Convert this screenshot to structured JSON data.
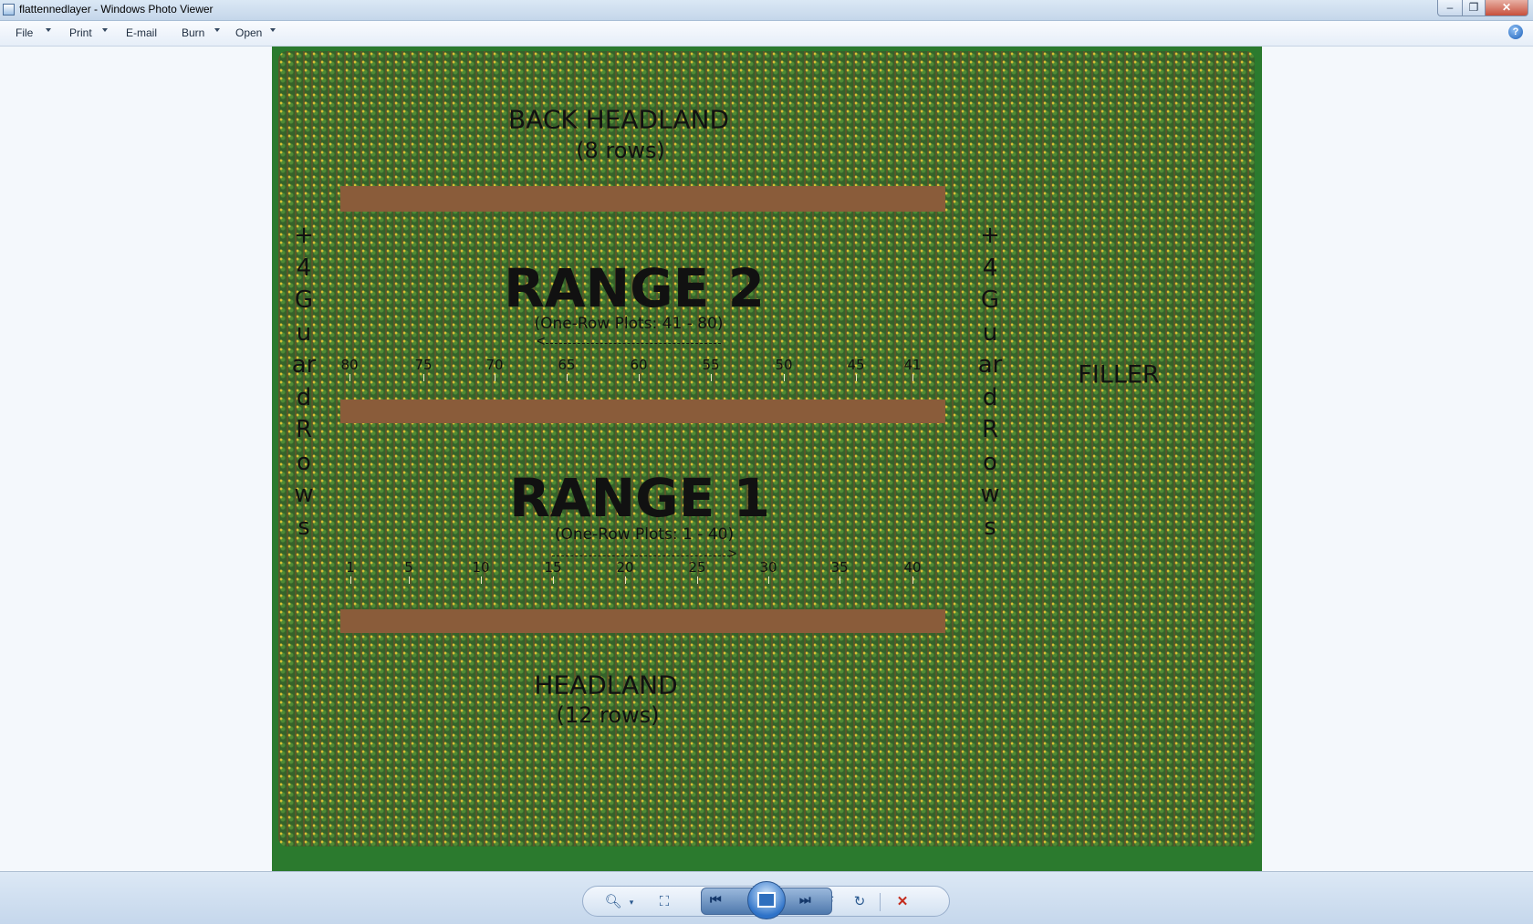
{
  "window": {
    "title": "flattennedlayer - Windows Photo Viewer",
    "min_glyph": "–",
    "max_glyph": "❐",
    "close_glyph": "✕"
  },
  "menu": {
    "file": "File",
    "print": "Print",
    "email": "E-mail",
    "burn": "Burn",
    "open": "Open",
    "help_glyph": "?"
  },
  "field": {
    "back_headland": "BACK HEADLAND",
    "back_headland_rows": "(8 rows)",
    "range2": "RANGE 2",
    "range2_plots": "(One-Row Plots: 41 - 80)",
    "range1": "RANGE 1",
    "range1_plots": "(One-Row Plots: 1 - 40)",
    "headland": "HEADLAND",
    "headland_rows": "(12 rows)",
    "filler": "FILLER",
    "guard_rows": "+4GuardRows",
    "range2_numbers": [
      "80",
      "75",
      "70",
      "65",
      "60",
      "55",
      "50",
      "45",
      "41"
    ],
    "range1_numbers": [
      "1",
      "5",
      "10",
      "15",
      "20",
      "25",
      "30",
      "35",
      "40"
    ],
    "arrow_left": "<",
    "arrow_right": ">"
  },
  "controls": {
    "zoom_icon": "magnifier-icon",
    "zoom_glyph": "🔍︎",
    "fit_glyph": "⛶",
    "prev_glyph": "⏮",
    "next_glyph": "⏭",
    "rotate_ccw_glyph": "↺",
    "rotate_cw_glyph": "↻",
    "delete_glyph": "✕"
  },
  "colors": {
    "field_green": "#35622a",
    "soil_brown": "#8a5c3a",
    "border_green": "#2b7a2e",
    "delete_red": "#c42b1c"
  }
}
